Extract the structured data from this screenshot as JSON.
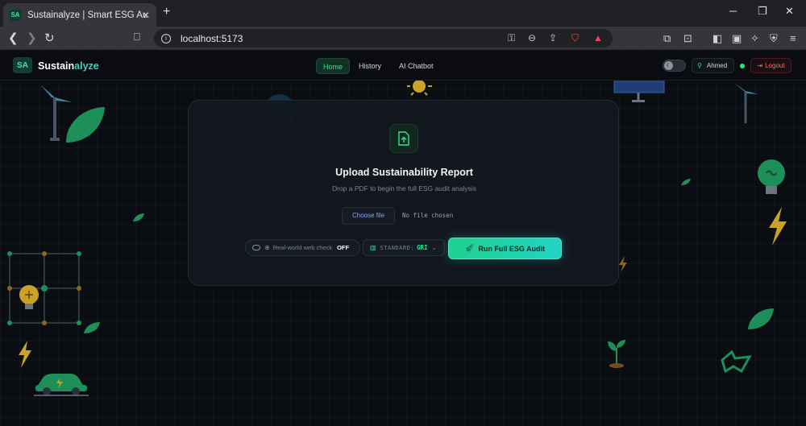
{
  "browser": {
    "tab_title": "Sustainalyze | Smart ESG Auditor",
    "tab_favicon": "SA",
    "url": "localhost:5173"
  },
  "app": {
    "logo_mark": "SA",
    "brand_part1": "Sustain",
    "brand_part2": "alyze",
    "nav": [
      {
        "label": "Home",
        "active": true
      },
      {
        "label": "History",
        "active": false
      },
      {
        "label": "AI Chatbot",
        "active": false
      }
    ],
    "user": {
      "name": "Ahmed"
    },
    "logout_label": "Logout",
    "accent": "#35e08f",
    "danger": "#ff6b6b"
  },
  "upload": {
    "title": "Upload Sustainability Report",
    "subtitle": "Drop a PDF to begin the full ESG audit analysis",
    "choose_file": "Choose file",
    "file_status": "No file chosen",
    "web_check_label": "Real-world web check",
    "web_check_state": "OFF",
    "standard_label": "STANDARD:",
    "standard_value": "GRI",
    "run_label": "Run Full ESG Audit"
  }
}
